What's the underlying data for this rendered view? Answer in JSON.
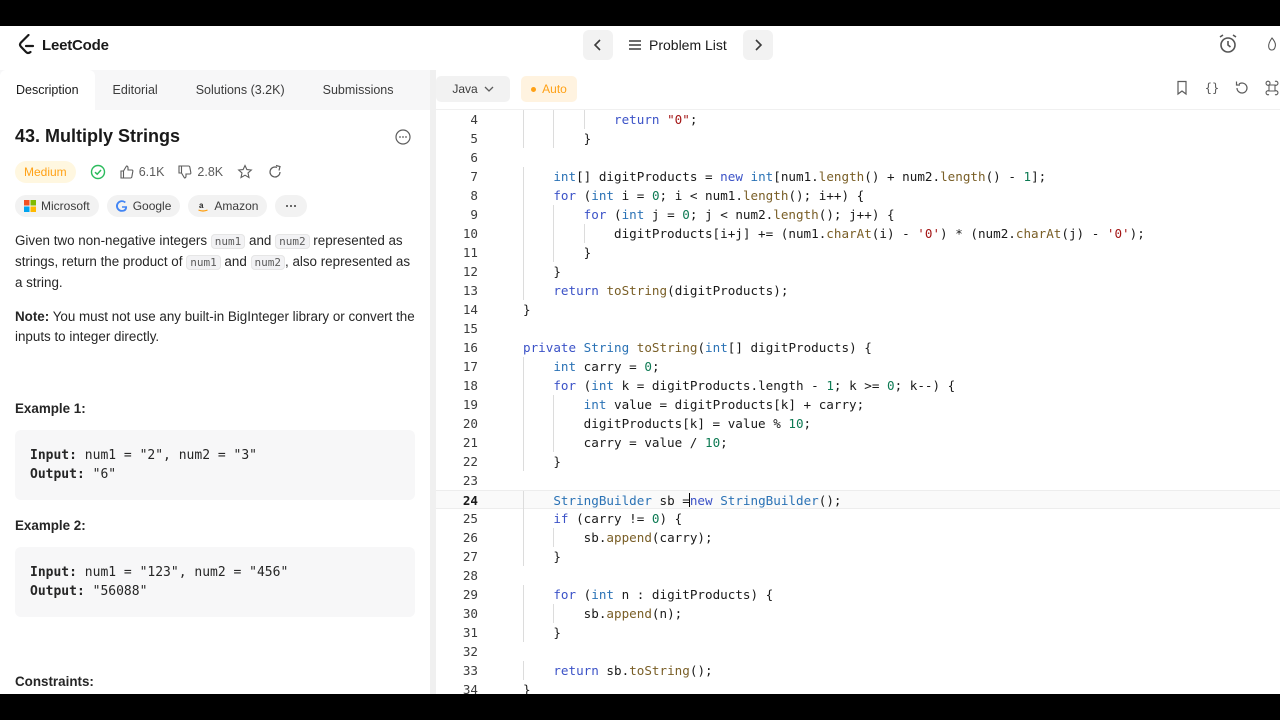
{
  "app": {
    "brand": "LeetCode"
  },
  "topnav": {
    "problem_list_label": "Problem List"
  },
  "tabs": [
    {
      "label": "Description"
    },
    {
      "label": "Editorial"
    },
    {
      "label": "Solutions (3.2K)"
    },
    {
      "label": "Submissions"
    }
  ],
  "problem": {
    "title": "43. Multiply Strings",
    "difficulty": "Medium",
    "likes": "6.1K",
    "dislikes": "2.8K",
    "companies": [
      "Microsoft",
      "Google",
      "Amazon"
    ],
    "desc_1": "Given two non-negative integers ",
    "code_num1": "num1",
    "desc_2": " and ",
    "code_num2": "num2",
    "desc_3": " represented as strings, return the product of ",
    "desc_4": ", also represented as a string.",
    "note_label": "Note:",
    "note_text": " You must not use any built-in BigInteger library or convert the inputs to integer directly.",
    "example1_title": "Example 1:",
    "example1_input_label": "Input:",
    "example1_input": " num1 = \"2\", num2 = \"3\"",
    "example1_output_label": "Output:",
    "example1_output": " \"6\"",
    "example2_title": "Example 2:",
    "example2_input_label": "Input:",
    "example2_input": " num1 = \"123\", num2 = \"456\"",
    "example2_output_label": "Output:",
    "example2_output": " \"56088\"",
    "constraints_title": "Constraints:"
  },
  "editor": {
    "language": "Java",
    "mode": "Auto",
    "current_line": 24,
    "lines": [
      {
        "n": 4,
        "code": "            return \"0\";"
      },
      {
        "n": 5,
        "code": "        }"
      },
      {
        "n": 6,
        "code": ""
      },
      {
        "n": 7,
        "code": "    int[] digitProducts = new int[num1.length() + num2.length() - 1];"
      },
      {
        "n": 8,
        "code": "    for (int i = 0; i < num1.length(); i++) {"
      },
      {
        "n": 9,
        "code": "        for (int j = 0; j < num2.length(); j++) {"
      },
      {
        "n": 10,
        "code": "            digitProducts[i+j] += (num1.charAt(i) - '0') * (num2.charAt(j) - '0');"
      },
      {
        "n": 11,
        "code": "        }"
      },
      {
        "n": 12,
        "code": "    }"
      },
      {
        "n": 13,
        "code": "    return toString(digitProducts);"
      },
      {
        "n": 14,
        "code": "}"
      },
      {
        "n": 15,
        "code": ""
      },
      {
        "n": 16,
        "code": "private String toString(int[] digitProducts) {"
      },
      {
        "n": 17,
        "code": "    int carry = 0;"
      },
      {
        "n": 18,
        "code": "    for (int k = digitProducts.length - 1; k >= 0; k--) {"
      },
      {
        "n": 19,
        "code": "        int value = digitProducts[k] + carry;"
      },
      {
        "n": 20,
        "code": "        digitProducts[k] = value % 10;"
      },
      {
        "n": 21,
        "code": "        carry = value / 10;"
      },
      {
        "n": 22,
        "code": "    }"
      },
      {
        "n": 23,
        "code": ""
      },
      {
        "n": 24,
        "code": "    StringBuilder sb = new StringBuilder();"
      },
      {
        "n": 25,
        "code": "    if (carry != 0) {"
      },
      {
        "n": 26,
        "code": "        sb.append(carry);"
      },
      {
        "n": 27,
        "code": "    }"
      },
      {
        "n": 28,
        "code": ""
      },
      {
        "n": 29,
        "code": "    for (int n : digitProducts) {"
      },
      {
        "n": 30,
        "code": "        sb.append(n);"
      },
      {
        "n": 31,
        "code": "    }"
      },
      {
        "n": 32,
        "code": ""
      },
      {
        "n": 33,
        "code": "    return sb.toString();"
      },
      {
        "n": 34,
        "code": "}"
      }
    ]
  }
}
